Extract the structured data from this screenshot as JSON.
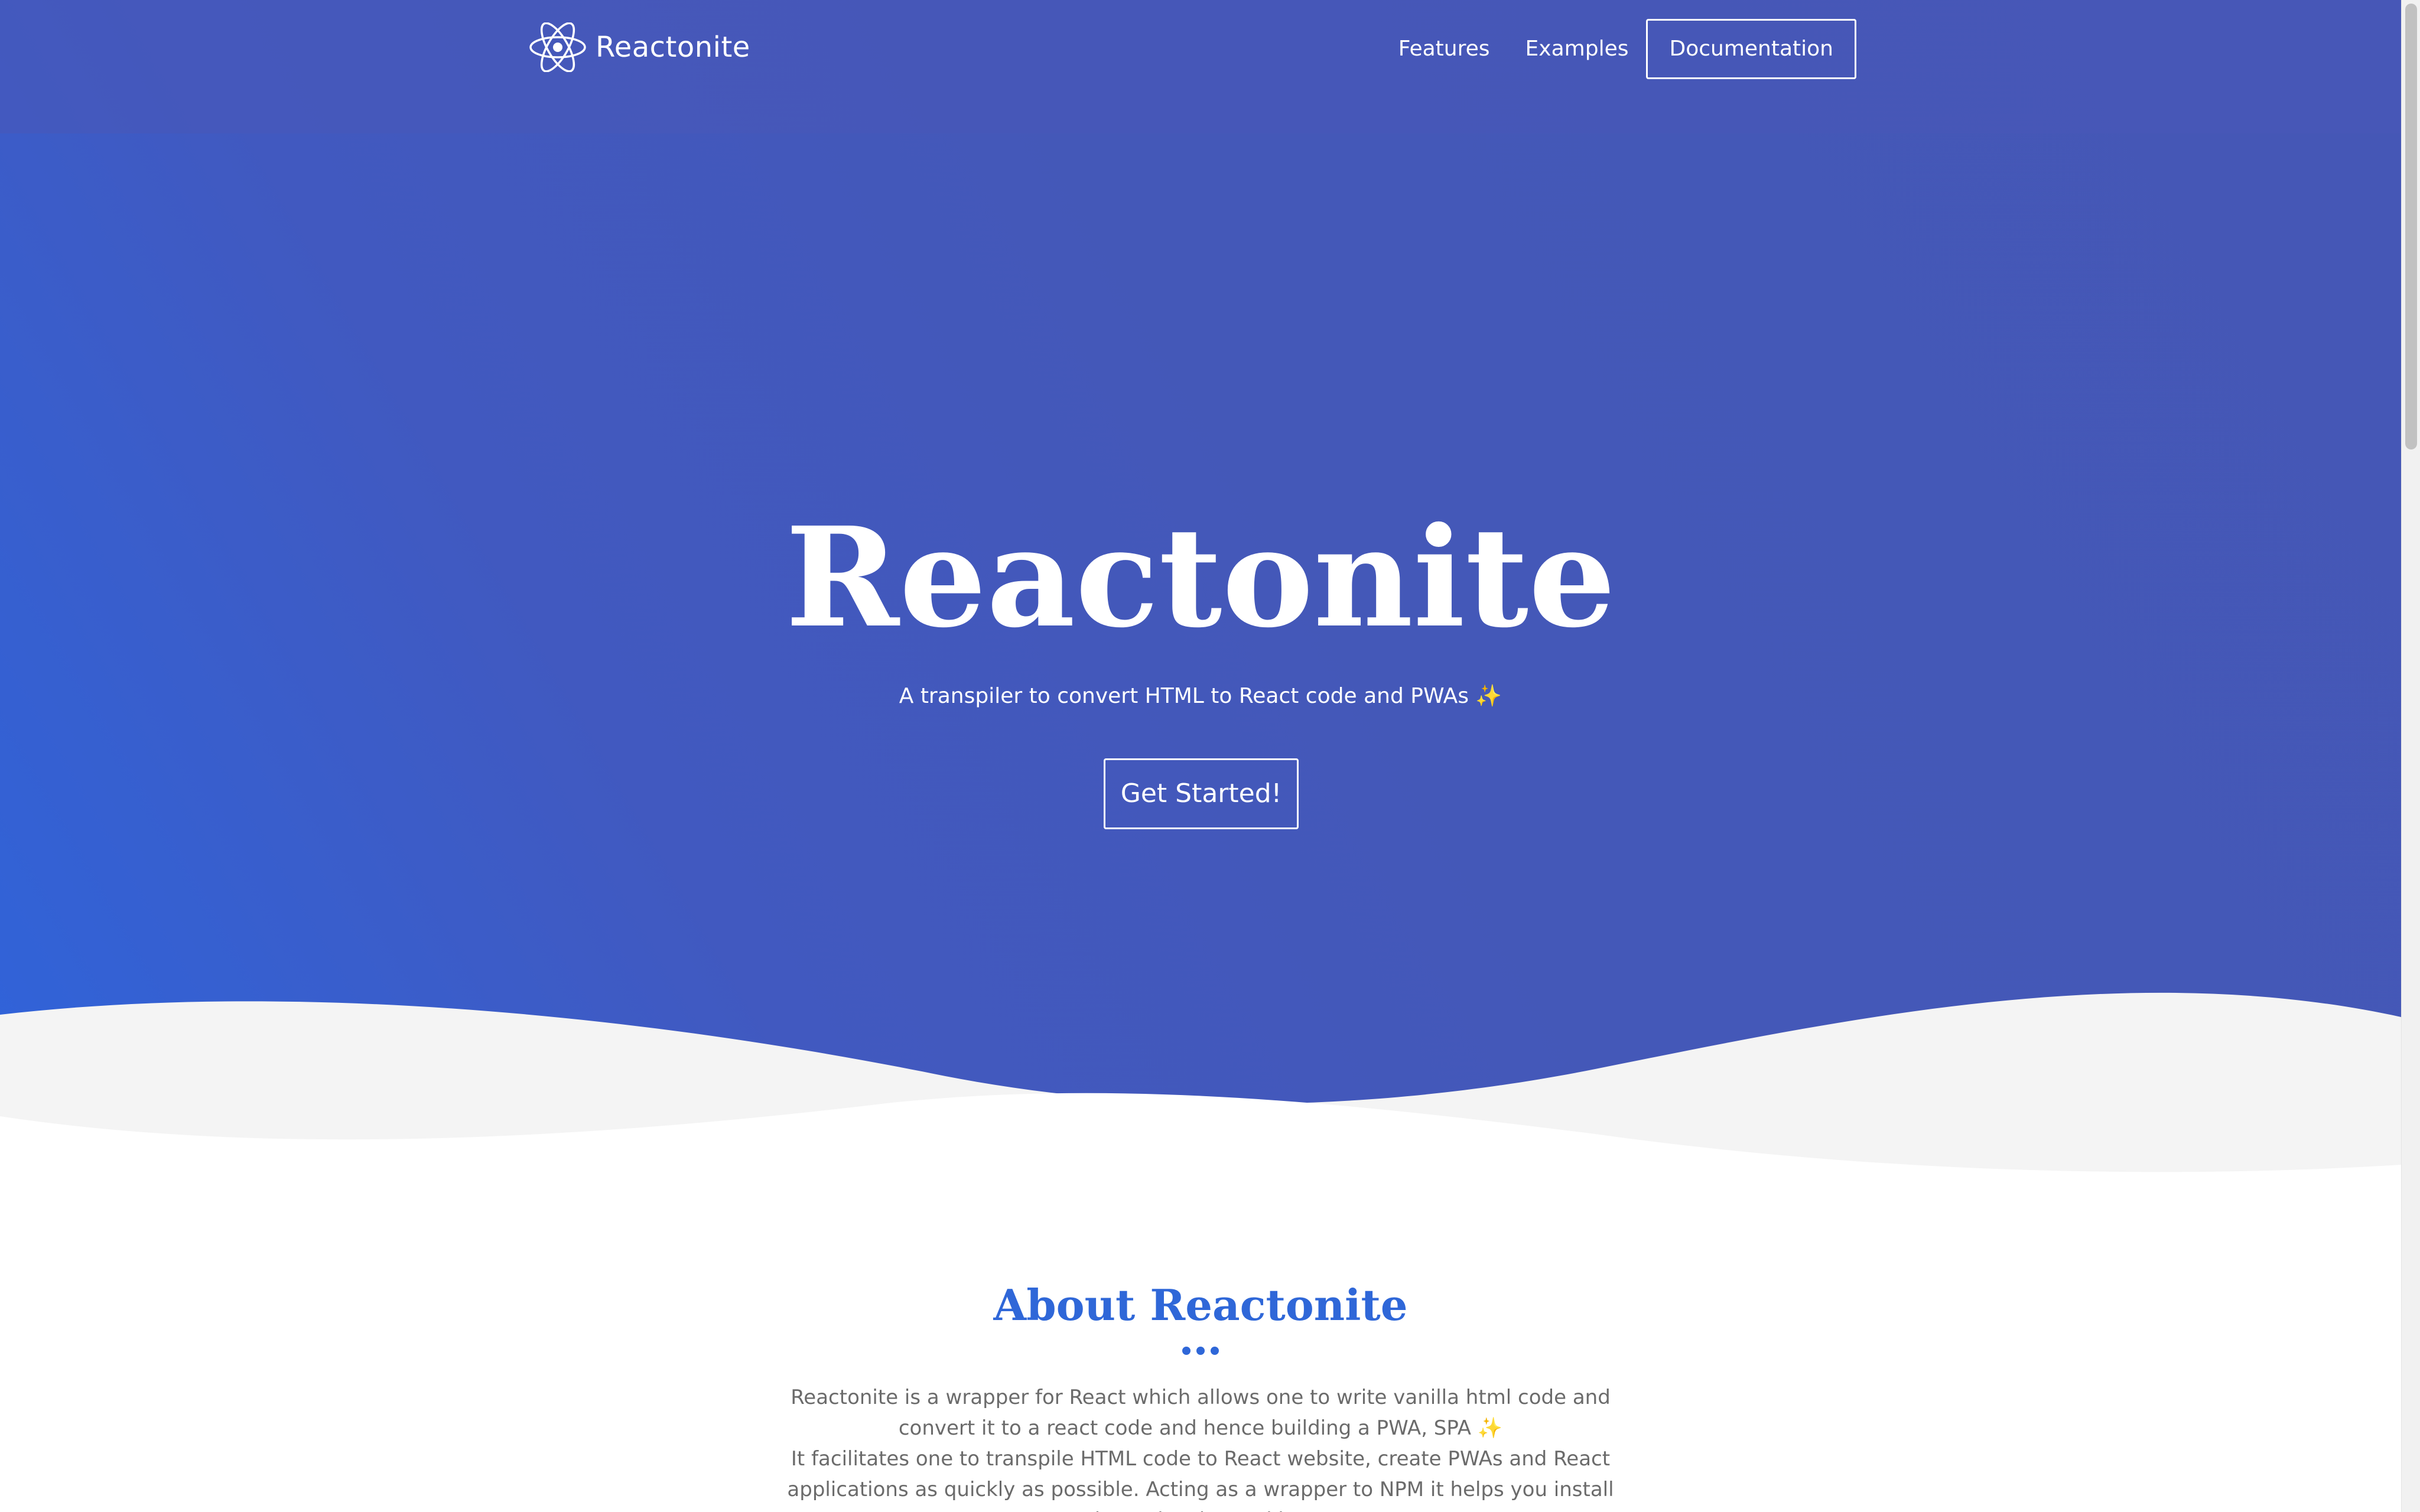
{
  "colors": {
    "hero_gradient_start": "#2f64db",
    "hero_gradient_end": "#4557b6",
    "accent": "#2f67d8",
    "body_text": "#6b6b6b",
    "wave_light": "#f4f4f4",
    "sparkle": "#f7d774"
  },
  "header": {
    "brand_icon": "react-atom-icon",
    "brand_name": "Reactonite",
    "nav": {
      "features": "Features",
      "examples": "Examples",
      "documentation": "Documentation"
    }
  },
  "hero": {
    "title": "Reactonite",
    "subtitle": "A transpiler to convert HTML to React code and PWAs",
    "subtitle_emoji": "✨",
    "cta_label": "Get Started!"
  },
  "about": {
    "title": "About Reactonite",
    "divider_icon": "three-dots-icon",
    "paragraph1": "Reactonite is a wrapper for React which allows one to write vanilla html code and convert it to a react code and hence building a PWA, SPA",
    "paragraph1_emoji": "✨",
    "paragraph2": "It facilitates one to transpile HTML code to React website, create PWAs and React applications as quickly as possible. Acting as a wrapper to NPM it helps you install dependencies and has"
  }
}
